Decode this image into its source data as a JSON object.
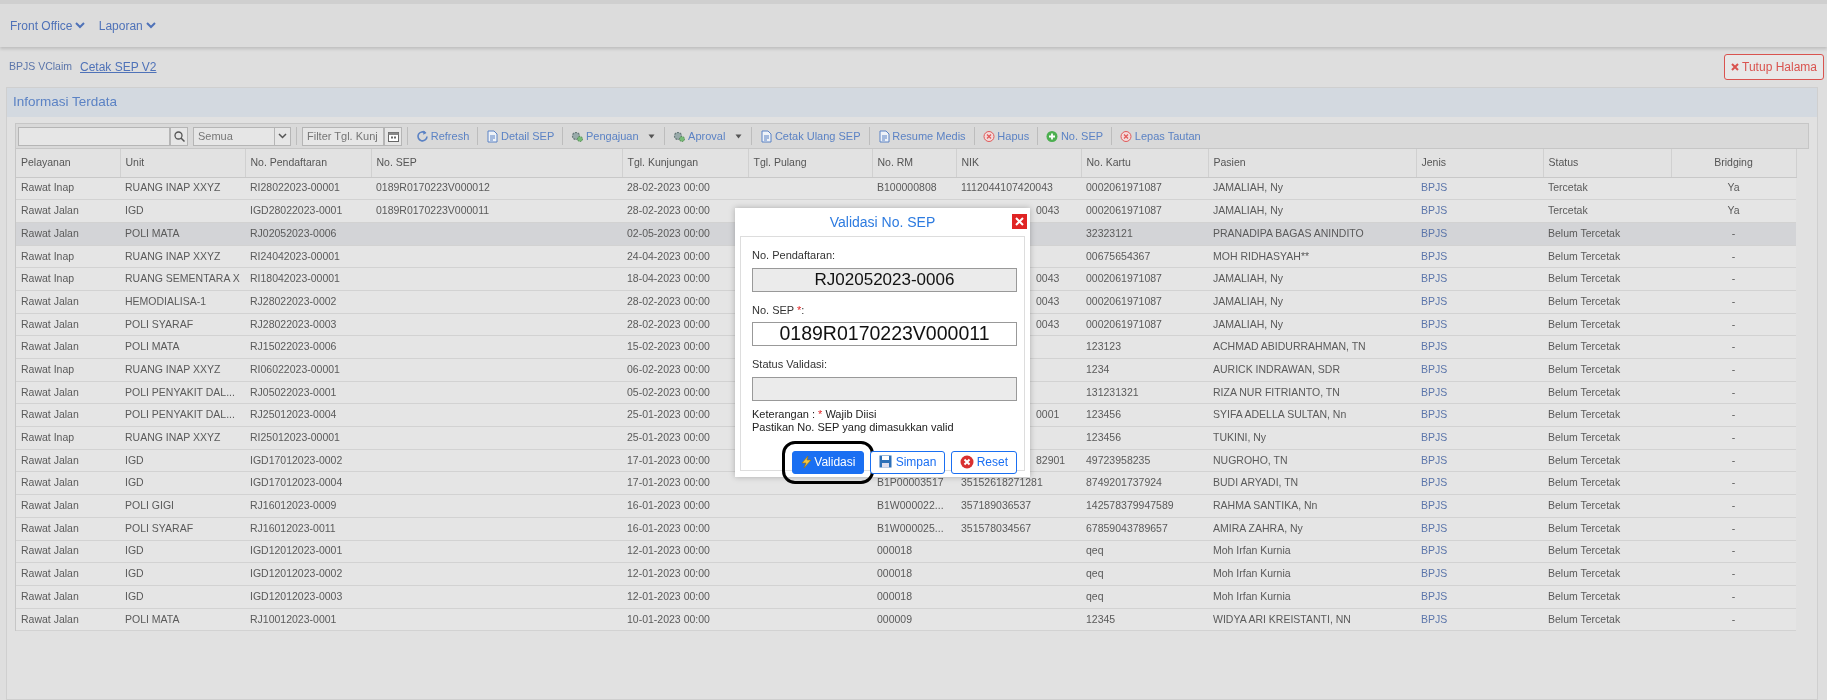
{
  "navbar": {
    "menus": [
      {
        "label": "Front Office"
      },
      {
        "label": "Laporan"
      }
    ]
  },
  "tabs": [
    {
      "label": "BPJS VClaim",
      "selected": false
    },
    {
      "label": "Cetak SEP V2",
      "selected": true
    }
  ],
  "close_page_button": {
    "label": "Tutup Halama"
  },
  "panel": {
    "title": "Informasi Terdata"
  },
  "toolbar": {
    "filter_select": {
      "value": "Semua"
    },
    "date_filter": {
      "placeholder": "Filter Tgl. Kunj"
    },
    "buttons": [
      {
        "label": "Refresh",
        "kind": "refresh",
        "dropdown": false
      },
      {
        "label": "Detail SEP",
        "kind": "document",
        "dropdown": false
      },
      {
        "label": "Pengajuan",
        "kind": "gear",
        "dropdown": true
      },
      {
        "label": "Aproval",
        "kind": "gear",
        "dropdown": true
      },
      {
        "label": "Cetak Ulang SEP",
        "kind": "document",
        "dropdown": false
      },
      {
        "label": "Resume Medis",
        "kind": "document",
        "dropdown": false
      },
      {
        "label": "Hapus",
        "kind": "delete",
        "dropdown": false
      },
      {
        "label": "No. SEP",
        "kind": "add",
        "dropdown": false
      },
      {
        "label": "Lepas Tautan",
        "kind": "delete",
        "dropdown": false
      }
    ]
  },
  "table": {
    "columns": [
      "Pelayanan",
      "Unit",
      "No. Pendaftaran",
      "No. SEP",
      "Tgl. Kunjungan",
      "Tgl. Pulang",
      "No. RM",
      "NIK",
      "No. Kartu",
      "Pasien",
      "Jenis",
      "Status",
      "Bridging"
    ],
    "rows": [
      {
        "pelayanan": "Rawat Inap",
        "unit": "RUANG INAP XXYZ",
        "no_pendaftaran": "RI28022023-00001",
        "no_sep": "0189R0170223V000012",
        "tgl_kunjungan": "28-02-2023 00:00",
        "no_rm": "B100000808",
        "nik": "1112044107420043",
        "no_kartu": "0002061971087",
        "pasien": "JAMALIAH, Ny",
        "jenis": "BPJS",
        "status": "Tercetak",
        "bridging": "Ya",
        "selected": false
      },
      {
        "pelayanan": "Rawat Jalan",
        "unit": "IGD",
        "no_pendaftaran": "IGD28022023-0001",
        "no_sep": "0189R0170223V000011",
        "tgl_kunjungan": "28-02-2023 00:00",
        "nik": "0043",
        "no_kartu": "0002061971087",
        "pasien": "JAMALIAH, Ny",
        "jenis": "BPJS",
        "status": "Tercetak",
        "bridging": "Ya",
        "selected": false
      },
      {
        "pelayanan": "Rawat Jalan",
        "unit": "POLI MATA",
        "no_pendaftaran": "RJ02052023-0006",
        "tgl_kunjungan": "02-05-2023 00:00",
        "no_kartu": "32323121",
        "pasien": "PRANADIPA BAGAS ANINDITO",
        "jenis": "BPJS",
        "status": "Belum Tercetak",
        "bridging": "-",
        "selected": true
      },
      {
        "pelayanan": "Rawat Inap",
        "unit": "RUANG INAP XXYZ",
        "no_pendaftaran": "RI24042023-00001",
        "tgl_kunjungan": "24-04-2023 00:00",
        "no_kartu": "00675654367",
        "pasien": "MOH RIDHASYAH**",
        "jenis": "BPJS",
        "status": "Belum Tercetak",
        "bridging": "-",
        "selected": false
      },
      {
        "pelayanan": "Rawat Inap",
        "unit": "RUANG SEMENTARA X",
        "no_pendaftaran": "RI18042023-00001",
        "tgl_kunjungan": "18-04-2023 00:00",
        "nik": "0043",
        "no_kartu": "0002061971087",
        "pasien": "JAMALIAH, Ny",
        "jenis": "BPJS",
        "status": "Belum Tercetak",
        "bridging": "-",
        "selected": false
      },
      {
        "pelayanan": "Rawat Jalan",
        "unit": "HEMODIALISA-1",
        "no_pendaftaran": "RJ28022023-0002",
        "tgl_kunjungan": "28-02-2023 00:00",
        "nik": "0043",
        "no_kartu": "0002061971087",
        "pasien": "JAMALIAH, Ny",
        "jenis": "BPJS",
        "status": "Belum Tercetak",
        "bridging": "-",
        "selected": false
      },
      {
        "pelayanan": "Rawat Jalan",
        "unit": "POLI SYARAF",
        "no_pendaftaran": "RJ28022023-0003",
        "tgl_kunjungan": "28-02-2023 00:00",
        "nik": "0043",
        "no_kartu": "0002061971087",
        "pasien": "JAMALIAH, Ny",
        "jenis": "BPJS",
        "status": "Belum Tercetak",
        "bridging": "-",
        "selected": false
      },
      {
        "pelayanan": "Rawat Jalan",
        "unit": "POLI MATA",
        "no_pendaftaran": "RJ15022023-0006",
        "tgl_kunjungan": "15-02-2023 00:00",
        "no_kartu": "123123",
        "pasien": "ACHMAD ABIDURRAHMAN, TN",
        "jenis": "BPJS",
        "status": "Belum Tercetak",
        "bridging": "-",
        "selected": false
      },
      {
        "pelayanan": "Rawat Inap",
        "unit": "RUANG INAP XXYZ",
        "no_pendaftaran": "RI06022023-00001",
        "tgl_kunjungan": "06-02-2023 00:00",
        "no_kartu": "1234",
        "pasien": "AURICK INDRAWAN, SDR",
        "jenis": "BPJS",
        "status": "Belum Tercetak",
        "bridging": "-",
        "selected": false
      },
      {
        "pelayanan": "Rawat Jalan",
        "unit": "POLI PENYAKIT DAL...",
        "no_pendaftaran": "RJ05022023-0001",
        "tgl_kunjungan": "05-02-2023 00:00",
        "no_kartu": "131231321",
        "pasien": "RIZA NUR FITRIANTO, TN",
        "jenis": "BPJS",
        "status": "Belum Tercetak",
        "bridging": "-",
        "selected": false
      },
      {
        "pelayanan": "Rawat Jalan",
        "unit": "POLI PENYAKIT DAL...",
        "no_pendaftaran": "RJ25012023-0004",
        "tgl_kunjungan": "25-01-2023 00:00",
        "nik": "0001",
        "no_kartu": "123456",
        "pasien": "SYIFA ADELLA SULTAN, Nn",
        "jenis": "BPJS",
        "status": "Belum Tercetak",
        "bridging": "-",
        "selected": false
      },
      {
        "pelayanan": "Rawat Inap",
        "unit": "RUANG INAP XXYZ",
        "no_pendaftaran": "RI25012023-00001",
        "tgl_kunjungan": "25-01-2023 00:00",
        "no_kartu": "123456",
        "pasien": "TUKINI, Ny",
        "jenis": "BPJS",
        "status": "Belum Tercetak",
        "bridging": "-",
        "selected": false
      },
      {
        "pelayanan": "Rawat Jalan",
        "unit": "IGD",
        "no_pendaftaran": "IGD17012023-0002",
        "tgl_kunjungan": "17-01-2023 00:00",
        "nik": "82901",
        "no_kartu": "49723958235",
        "pasien": "NUGROHO, TN",
        "jenis": "BPJS",
        "status": "Belum Tercetak",
        "bridging": "-",
        "selected": false
      },
      {
        "pelayanan": "Rawat Jalan",
        "unit": "IGD",
        "no_pendaftaran": "IGD17012023-0004",
        "tgl_kunjungan": "17-01-2023 00:00",
        "no_rm": "B1P00003517",
        "nik": "35152618271281",
        "no_kartu": "8749201737924",
        "pasien": "BUDI ARYADI, TN",
        "jenis": "BPJS",
        "status": "Belum Tercetak",
        "bridging": "-",
        "selected": false
      },
      {
        "pelayanan": "Rawat Jalan",
        "unit": "POLI GIGI",
        "no_pendaftaran": "RJ16012023-0009",
        "tgl_kunjungan": "16-01-2023 00:00",
        "no_rm": "B1W000022...",
        "nik": "357189036537",
        "no_kartu": "142578379947589",
        "pasien": "RAHMA SANTIKA, Nn",
        "jenis": "BPJS",
        "status": "Belum Tercetak",
        "bridging": "-",
        "selected": false
      },
      {
        "pelayanan": "Rawat Jalan",
        "unit": "POLI SYARAF",
        "no_pendaftaran": "RJ16012023-0011",
        "tgl_kunjungan": "16-01-2023 00:00",
        "no_rm": "B1W000025...",
        "nik": "351578034567",
        "no_kartu": "67859043789657",
        "pasien": "AMIRA ZAHRA, Ny",
        "jenis": "BPJS",
        "status": "Belum Tercetak",
        "bridging": "-",
        "selected": false
      },
      {
        "pelayanan": "Rawat Jalan",
        "unit": "IGD",
        "no_pendaftaran": "IGD12012023-0001",
        "tgl_kunjungan": "12-01-2023 00:00",
        "no_rm": "000018",
        "no_kartu": "qeq",
        "pasien": "Moh Irfan Kurnia",
        "jenis": "BPJS",
        "status": "Belum Tercetak",
        "bridging": "-",
        "selected": false
      },
      {
        "pelayanan": "Rawat Jalan",
        "unit": "IGD",
        "no_pendaftaran": "IGD12012023-0002",
        "tgl_kunjungan": "12-01-2023 00:00",
        "no_rm": "000018",
        "no_kartu": "qeq",
        "pasien": "Moh Irfan Kurnia",
        "jenis": "BPJS",
        "status": "Belum Tercetak",
        "bridging": "-",
        "selected": false
      },
      {
        "pelayanan": "Rawat Jalan",
        "unit": "IGD",
        "no_pendaftaran": "IGD12012023-0003",
        "tgl_kunjungan": "12-01-2023 00:00",
        "no_rm": "000018",
        "no_kartu": "qeq",
        "pasien": "Moh Irfan Kurnia",
        "jenis": "BPJS",
        "status": "Belum Tercetak",
        "bridging": "-",
        "selected": false
      },
      {
        "pelayanan": "Rawat Jalan",
        "unit": "POLI MATA",
        "no_pendaftaran": "RJ10012023-0001",
        "tgl_kunjungan": "10-01-2023 00:00",
        "no_rm": "000009",
        "no_kartu": "12345",
        "pasien": "WIDYA ARI KREISTANTI, NN",
        "jenis": "BPJS",
        "status": "Belum Tercetak",
        "bridging": "-",
        "selected": false
      }
    ]
  },
  "dialog": {
    "title": "Validasi No. SEP",
    "fields": [
      {
        "label_parts": [
          {
            "text": "No. Pendaftaran:",
            "kind": "plain"
          }
        ],
        "value": "RJ02052023-0006",
        "disabled": true
      },
      {
        "label_parts": [
          {
            "text": "No. SEP ",
            "kind": "plain"
          },
          {
            "text": "*",
            "kind": "required"
          },
          {
            "text": ":",
            "kind": "plain"
          }
        ],
        "value": "0189R0170223V000011",
        "disabled": false
      },
      {
        "label_parts": [
          {
            "text": "Status Validasi:",
            "kind": "plain"
          }
        ],
        "disabled": true
      }
    ],
    "notes": [
      [
        {
          "text": "Keterangan : ",
          "kind": "plain"
        },
        {
          "text": "*",
          "kind": "required"
        },
        {
          "text": " Wajib Diisi",
          "kind": "plain"
        }
      ],
      [
        {
          "text": "Pastikan No. SEP yang dimasukkan valid",
          "kind": "plain"
        }
      ]
    ],
    "buttons": [
      {
        "label": "Validasi",
        "kind": "validate",
        "focused": true
      },
      {
        "label": "Simpan",
        "kind": "save",
        "focused": false
      },
      {
        "label": "Reset",
        "kind": "reset",
        "focused": false
      }
    ]
  }
}
